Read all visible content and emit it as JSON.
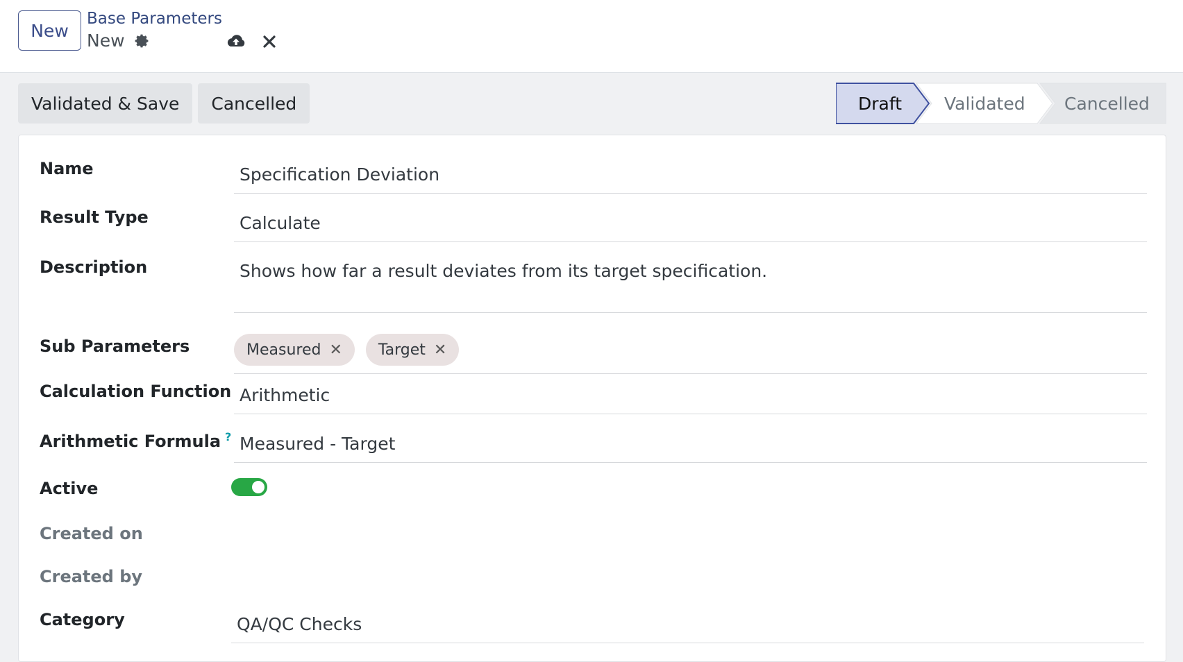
{
  "header": {
    "new_label": "New",
    "breadcrumb": "Base Parameters",
    "record_name": "New"
  },
  "actions": {
    "validate_save": "Validated & Save",
    "cancel": "Cancelled"
  },
  "statusbar": {
    "stages": [
      "Draft",
      "Validated",
      "Cancelled"
    ],
    "active": "Draft"
  },
  "form": {
    "name_label": "Name",
    "name_value": "Specification Deviation",
    "result_type_label": "Result Type",
    "result_type_value": "Calculate",
    "description_label": "Description",
    "description_value": "Shows how far a result deviates from its target specification.",
    "sub_parameters_label": "Sub Parameters",
    "sub_parameters": [
      "Measured",
      "Target"
    ],
    "calc_function_label": "Calculation Function",
    "calc_function_value": "Arithmetic",
    "formula_label": "Arithmetic Formula",
    "formula_help": "?",
    "formula_value": "Measured - Target",
    "active_label": "Active",
    "active_value": true,
    "created_on_label": "Created on",
    "created_by_label": "Created by",
    "category_label": "Category",
    "category_value": "QA/QC Checks"
  },
  "colors": {
    "accent": "#3b4d8a",
    "toggle_on": "#28a745",
    "tag_bg": "#e9e1e1"
  }
}
